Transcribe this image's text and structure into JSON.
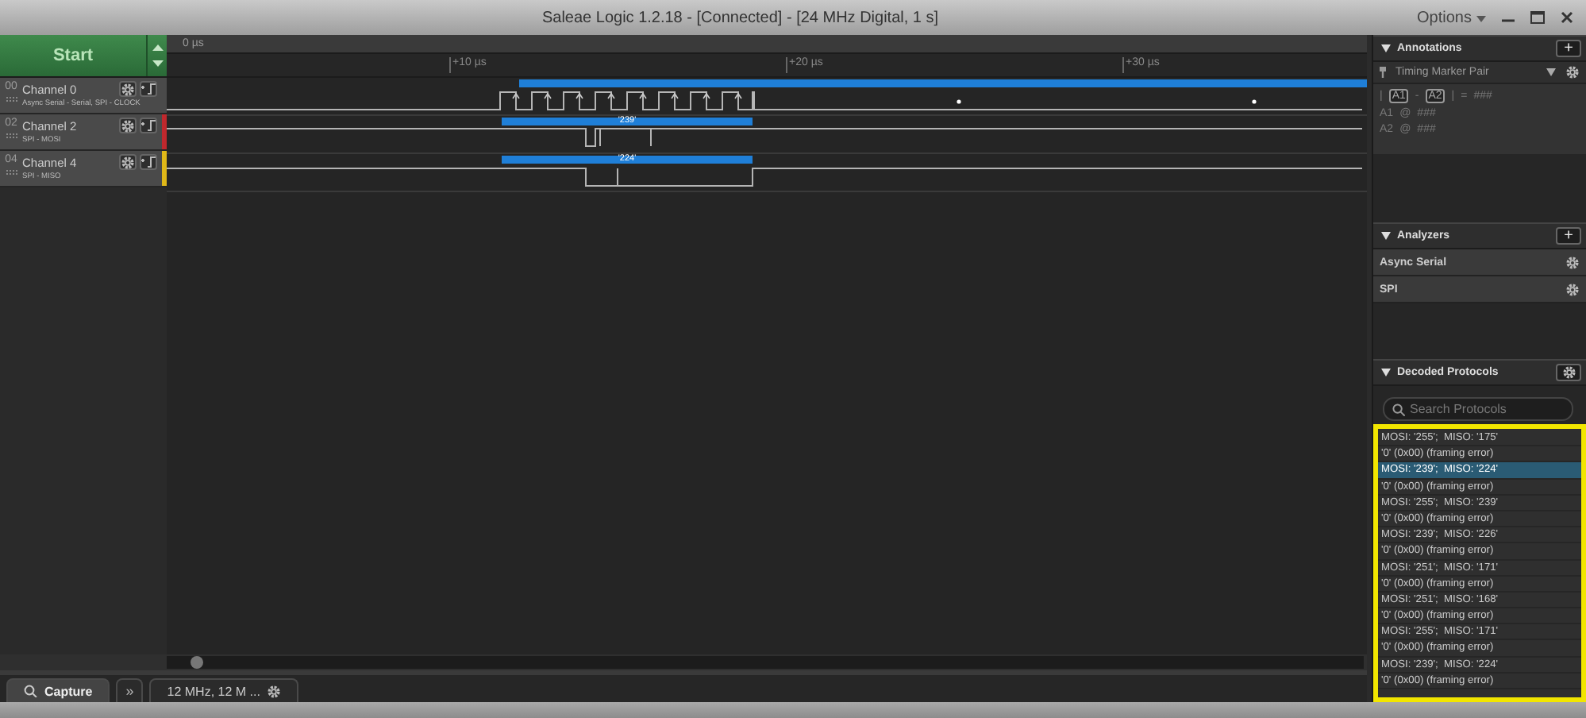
{
  "window": {
    "title": "Saleae Logic 1.2.18 - [Connected] - [24 MHz Digital, 1 s]",
    "menu": "Options"
  },
  "start_button": {
    "label": "Start"
  },
  "timeline": {
    "origin": "0 µs",
    "ticks": [
      "+10 µs",
      "+20 µs",
      "+30 µs"
    ]
  },
  "channels": [
    {
      "number": "00",
      "name": "Channel 0",
      "subtitle": "Async Serial - Serial, SPI - CLOCK",
      "kind": "clock"
    },
    {
      "number": "02",
      "name": "Channel 2",
      "subtitle": "SPI - MOSI",
      "kind": "mosi",
      "color": "#c0282d",
      "bubble": "'239'"
    },
    {
      "number": "04",
      "name": "Channel 4",
      "subtitle": "SPI - MISO",
      "kind": "miso",
      "color": "#e0b818",
      "bubble": "'224'"
    }
  ],
  "annotations": {
    "title": "Annotations",
    "add": "+",
    "marker": "Timing Marker Pair",
    "rows": [
      [
        {
          "kind": "text",
          "text": "|"
        },
        {
          "kind": "chip",
          "text": "A1"
        },
        {
          "kind": "text",
          "text": "-"
        },
        {
          "kind": "chip",
          "text": "A2"
        },
        {
          "kind": "text",
          "text": "|"
        },
        {
          "kind": "text",
          "text": "="
        },
        {
          "kind": "text",
          "text": "###"
        }
      ],
      [
        {
          "kind": "text",
          "text": "A1"
        },
        {
          "kind": "text",
          "text": "@"
        },
        {
          "kind": "text",
          "text": "###"
        }
      ],
      [
        {
          "kind": "text",
          "text": "A2"
        },
        {
          "kind": "text",
          "text": "@"
        },
        {
          "kind": "text",
          "text": "###"
        }
      ]
    ]
  },
  "analyzers": {
    "title": "Analyzers",
    "add": "+",
    "items": [
      {
        "name": "Async Serial"
      },
      {
        "name": "SPI"
      }
    ]
  },
  "decoded": {
    "title": "Decoded Protocols",
    "search": {
      "placeholder": "Search Protocols"
    },
    "highlighted": true,
    "rows": [
      {
        "text": "MOSI: '255';  MISO: '175'",
        "selected": false
      },
      {
        "text": "'0' (0x00) (framing error)",
        "selected": false
      },
      {
        "text": "MOSI: '239';  MISO: '224'",
        "selected": true
      },
      {
        "text": "'0' (0x00) (framing error)",
        "selected": false
      },
      {
        "text": "MOSI: '255';  MISO: '239'",
        "selected": false
      },
      {
        "text": "'0' (0x00) (framing error)",
        "selected": false
      },
      {
        "text": "MOSI: '239';  MISO: '226'",
        "selected": false
      },
      {
        "text": "'0' (0x00) (framing error)",
        "selected": false
      },
      {
        "text": "MOSI: '251';  MISO: '171'",
        "selected": false
      },
      {
        "text": "'0' (0x00) (framing error)",
        "selected": false
      },
      {
        "text": "MOSI: '251';  MISO: '168'",
        "selected": false
      },
      {
        "text": "'0' (0x00) (framing error)",
        "selected": false
      },
      {
        "text": "MOSI: '255';  MISO: '171'",
        "selected": false
      },
      {
        "text": "'0' (0x00) (framing error)",
        "selected": false
      },
      {
        "text": "MOSI: '239';  MISO: '224'",
        "selected": false
      },
      {
        "text": "'0' (0x00) (framing error)",
        "selected": false
      }
    ]
  },
  "bottom": {
    "more": "»",
    "tabs": [
      {
        "label": "Capture",
        "selected": true
      },
      {
        "label": "12 MHz, 12 M ...",
        "selected": false
      }
    ]
  }
}
